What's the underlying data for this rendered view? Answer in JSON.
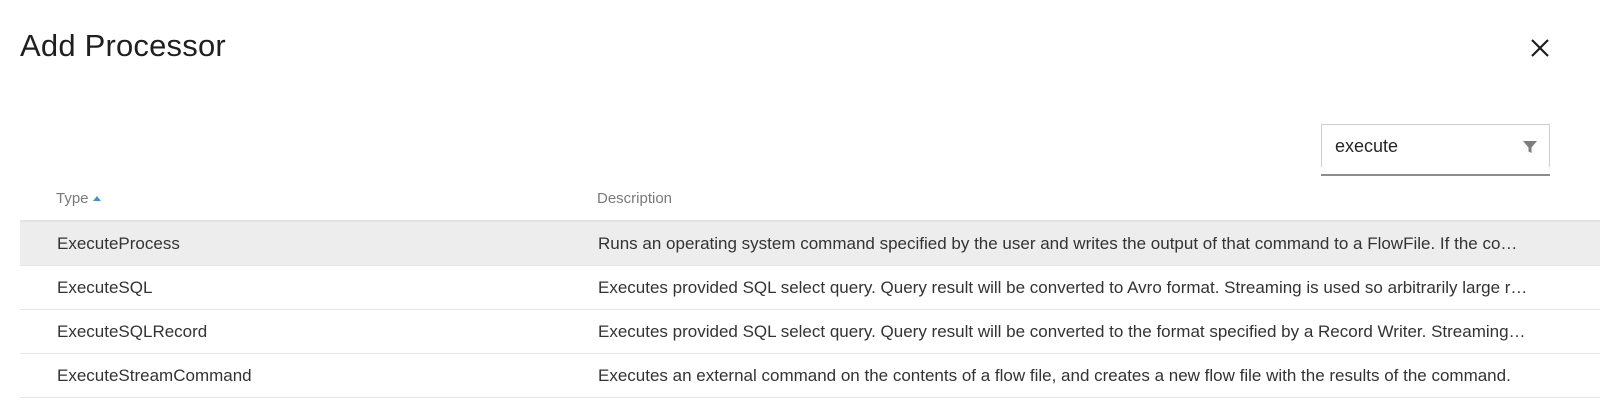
{
  "dialog": {
    "title": "Add Processor",
    "close_icon": "close-icon"
  },
  "filter": {
    "value": "execute",
    "icon": "filter-icon"
  },
  "table": {
    "columns": {
      "type": "Type",
      "description": "Description",
      "sort_icon": "sort-ascending-icon"
    },
    "rows": [
      {
        "type": "ExecuteProcess",
        "description": "Runs an operating system command specified by the user and writes the output of that command to a FlowFile. If the command is expected to be long-running, the Processor can output the partial data on a specified interval.",
        "selected": true
      },
      {
        "type": "ExecuteSQL",
        "description": "Executes provided SQL select query. Query result will be converted to Avro format. Streaming is used so arbitrarily large result sets are supported.",
        "selected": false
      },
      {
        "type": "ExecuteSQLRecord",
        "description": "Executes provided SQL select query. Query result will be converted to the format specified by a Record Writer. Streaming is used so arbitrarily large result sets are supported.",
        "selected": false
      },
      {
        "type": "ExecuteStreamCommand",
        "description": "Executes an external command on the contents of a flow file, and creates a new flow file with the results of the command.",
        "selected": false
      }
    ]
  },
  "colors": {
    "selected_row": "#ededed",
    "sort_accent": "#4a90c7"
  }
}
